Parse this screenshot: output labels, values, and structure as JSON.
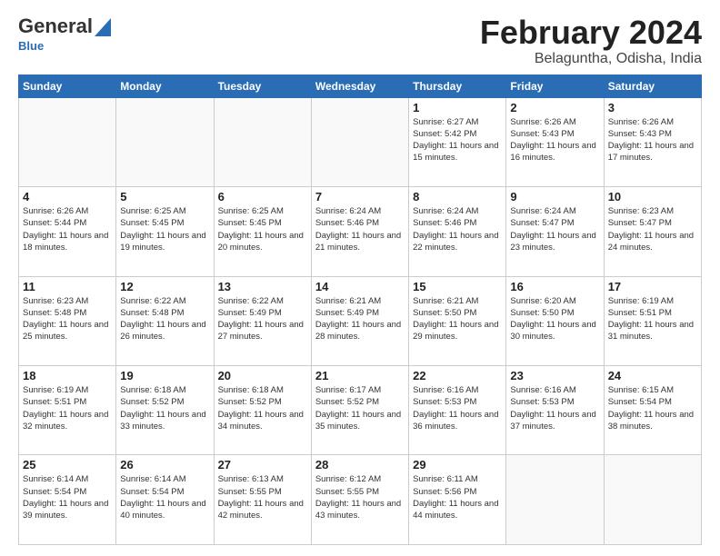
{
  "logo": {
    "general": "General",
    "blue": "Blue",
    "sub": "Blue"
  },
  "title": "February 2024",
  "location": "Belaguntha, Odisha, India",
  "headers": [
    "Sunday",
    "Monday",
    "Tuesday",
    "Wednesday",
    "Thursday",
    "Friday",
    "Saturday"
  ],
  "weeks": [
    [
      {
        "day": "",
        "info": ""
      },
      {
        "day": "",
        "info": ""
      },
      {
        "day": "",
        "info": ""
      },
      {
        "day": "",
        "info": ""
      },
      {
        "day": "1",
        "sunrise": "6:27 AM",
        "sunset": "5:42 PM",
        "daylight": "11 hours and 15 minutes."
      },
      {
        "day": "2",
        "sunrise": "6:26 AM",
        "sunset": "5:43 PM",
        "daylight": "11 hours and 16 minutes."
      },
      {
        "day": "3",
        "sunrise": "6:26 AM",
        "sunset": "5:43 PM",
        "daylight": "11 hours and 17 minutes."
      }
    ],
    [
      {
        "day": "4",
        "sunrise": "6:26 AM",
        "sunset": "5:44 PM",
        "daylight": "11 hours and 18 minutes."
      },
      {
        "day": "5",
        "sunrise": "6:25 AM",
        "sunset": "5:45 PM",
        "daylight": "11 hours and 19 minutes."
      },
      {
        "day": "6",
        "sunrise": "6:25 AM",
        "sunset": "5:45 PM",
        "daylight": "11 hours and 20 minutes."
      },
      {
        "day": "7",
        "sunrise": "6:24 AM",
        "sunset": "5:46 PM",
        "daylight": "11 hours and 21 minutes."
      },
      {
        "day": "8",
        "sunrise": "6:24 AM",
        "sunset": "5:46 PM",
        "daylight": "11 hours and 22 minutes."
      },
      {
        "day": "9",
        "sunrise": "6:24 AM",
        "sunset": "5:47 PM",
        "daylight": "11 hours and 23 minutes."
      },
      {
        "day": "10",
        "sunrise": "6:23 AM",
        "sunset": "5:47 PM",
        "daylight": "11 hours and 24 minutes."
      }
    ],
    [
      {
        "day": "11",
        "sunrise": "6:23 AM",
        "sunset": "5:48 PM",
        "daylight": "11 hours and 25 minutes."
      },
      {
        "day": "12",
        "sunrise": "6:22 AM",
        "sunset": "5:48 PM",
        "daylight": "11 hours and 26 minutes."
      },
      {
        "day": "13",
        "sunrise": "6:22 AM",
        "sunset": "5:49 PM",
        "daylight": "11 hours and 27 minutes."
      },
      {
        "day": "14",
        "sunrise": "6:21 AM",
        "sunset": "5:49 PM",
        "daylight": "11 hours and 28 minutes."
      },
      {
        "day": "15",
        "sunrise": "6:21 AM",
        "sunset": "5:50 PM",
        "daylight": "11 hours and 29 minutes."
      },
      {
        "day": "16",
        "sunrise": "6:20 AM",
        "sunset": "5:50 PM",
        "daylight": "11 hours and 30 minutes."
      },
      {
        "day": "17",
        "sunrise": "6:19 AM",
        "sunset": "5:51 PM",
        "daylight": "11 hours and 31 minutes."
      }
    ],
    [
      {
        "day": "18",
        "sunrise": "6:19 AM",
        "sunset": "5:51 PM",
        "daylight": "11 hours and 32 minutes."
      },
      {
        "day": "19",
        "sunrise": "6:18 AM",
        "sunset": "5:52 PM",
        "daylight": "11 hours and 33 minutes."
      },
      {
        "day": "20",
        "sunrise": "6:18 AM",
        "sunset": "5:52 PM",
        "daylight": "11 hours and 34 minutes."
      },
      {
        "day": "21",
        "sunrise": "6:17 AM",
        "sunset": "5:52 PM",
        "daylight": "11 hours and 35 minutes."
      },
      {
        "day": "22",
        "sunrise": "6:16 AM",
        "sunset": "5:53 PM",
        "daylight": "11 hours and 36 minutes."
      },
      {
        "day": "23",
        "sunrise": "6:16 AM",
        "sunset": "5:53 PM",
        "daylight": "11 hours and 37 minutes."
      },
      {
        "day": "24",
        "sunrise": "6:15 AM",
        "sunset": "5:54 PM",
        "daylight": "11 hours and 38 minutes."
      }
    ],
    [
      {
        "day": "25",
        "sunrise": "6:14 AM",
        "sunset": "5:54 PM",
        "daylight": "11 hours and 39 minutes."
      },
      {
        "day": "26",
        "sunrise": "6:14 AM",
        "sunset": "5:54 PM",
        "daylight": "11 hours and 40 minutes."
      },
      {
        "day": "27",
        "sunrise": "6:13 AM",
        "sunset": "5:55 PM",
        "daylight": "11 hours and 42 minutes."
      },
      {
        "day": "28",
        "sunrise": "6:12 AM",
        "sunset": "5:55 PM",
        "daylight": "11 hours and 43 minutes."
      },
      {
        "day": "29",
        "sunrise": "6:11 AM",
        "sunset": "5:56 PM",
        "daylight": "11 hours and 44 minutes."
      },
      {
        "day": "",
        "info": ""
      },
      {
        "day": "",
        "info": ""
      }
    ]
  ]
}
